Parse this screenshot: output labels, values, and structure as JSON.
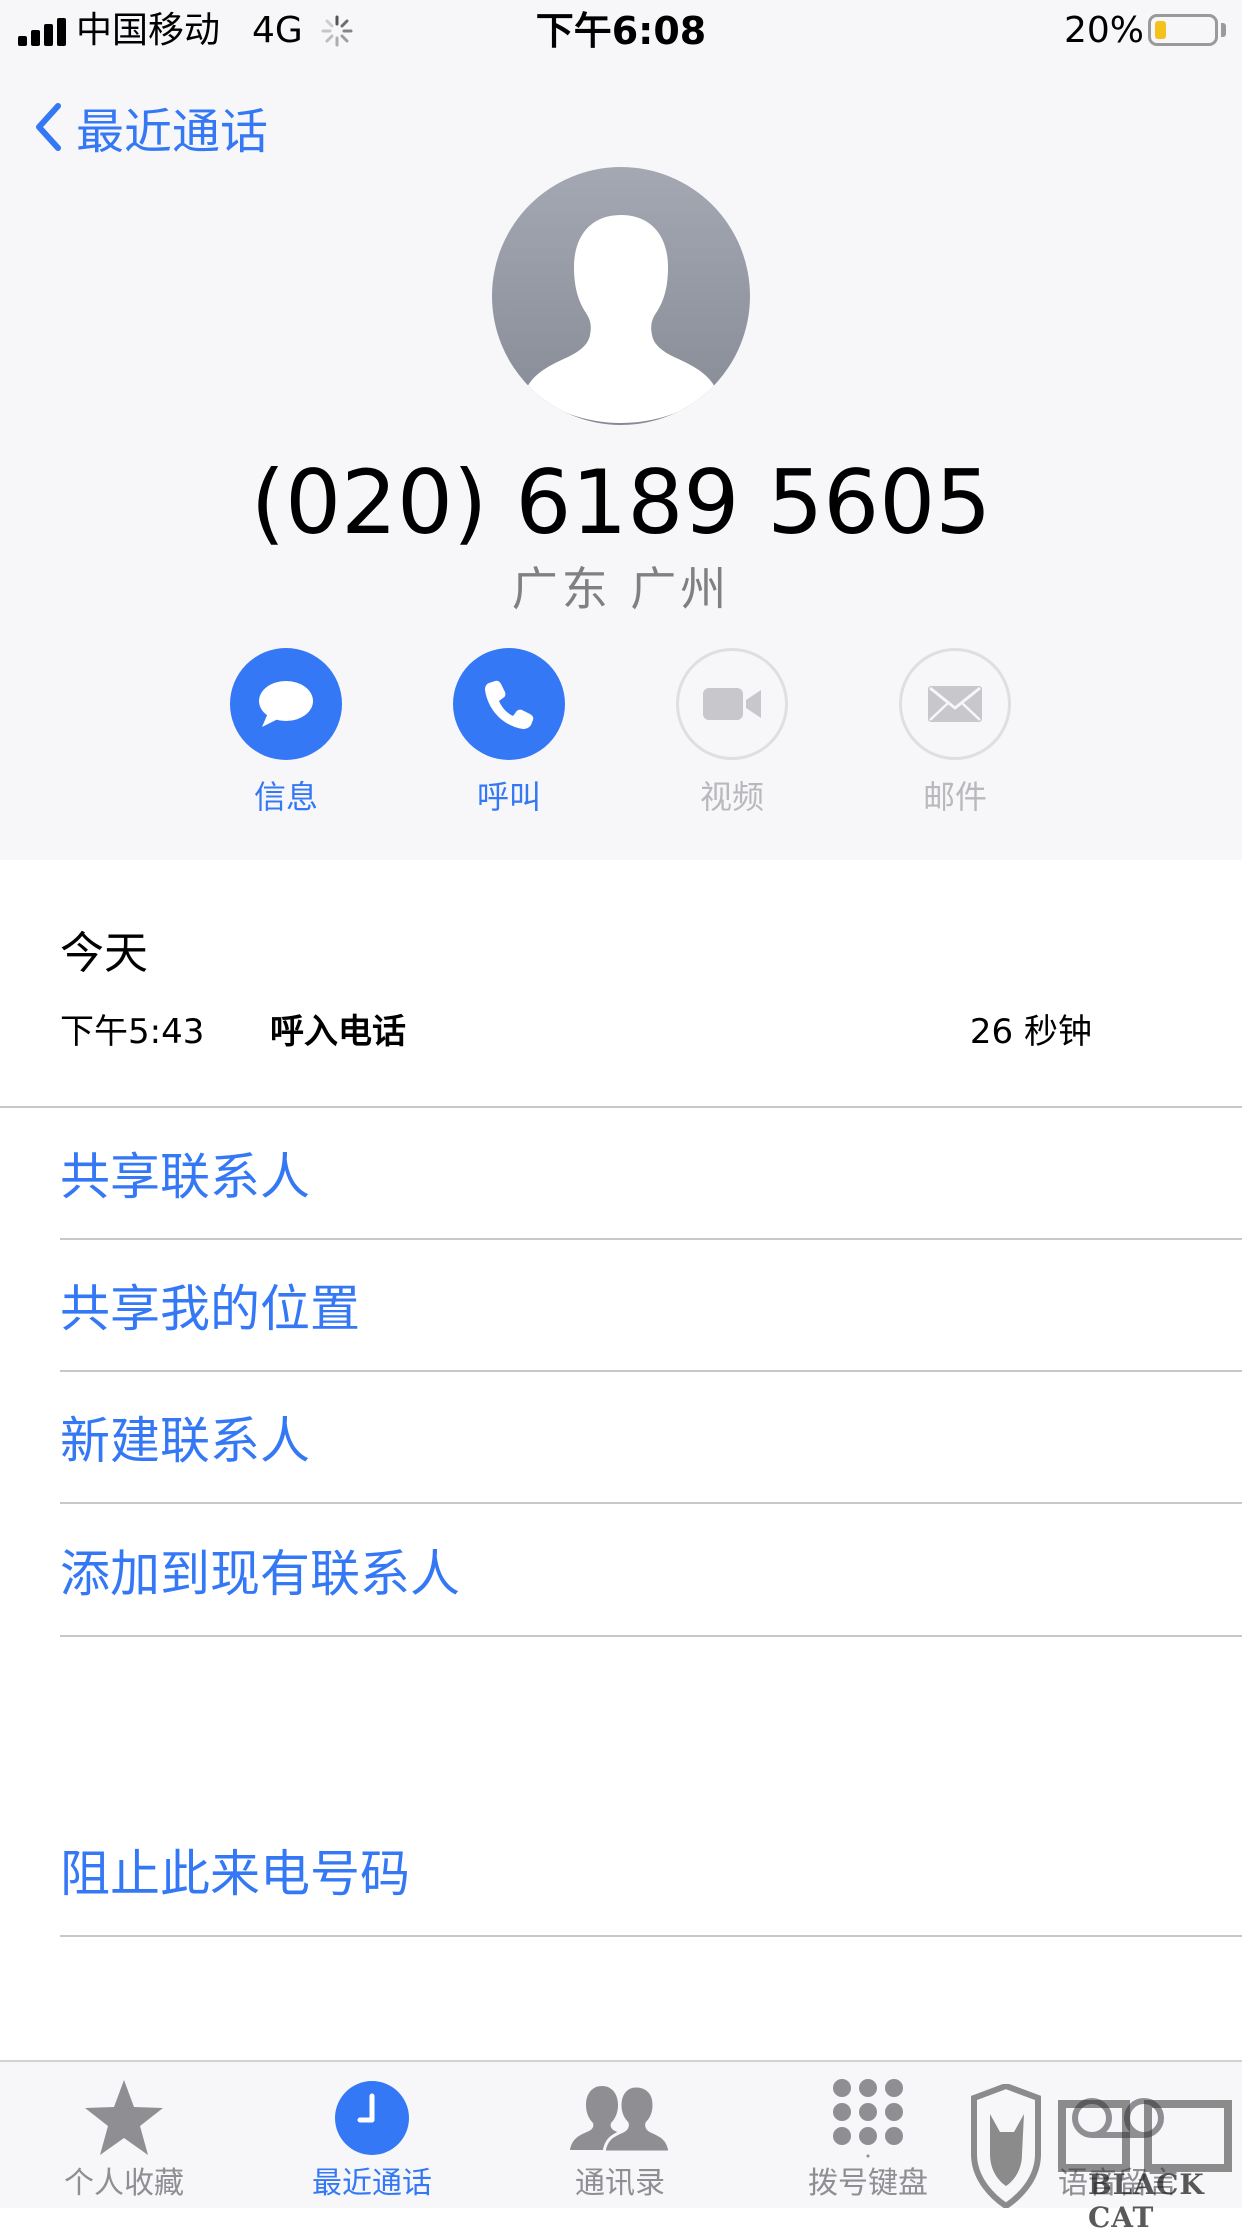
{
  "status_bar": {
    "carrier": "中国移动",
    "network": "4G",
    "time": "下午6:08",
    "battery_percent_text": "20%",
    "battery_level": 0.2,
    "battery_color": "#f4c21b"
  },
  "nav": {
    "back_label": "最近通话"
  },
  "contact": {
    "phone_number": "(020) 6189 5605",
    "location": "广东 广州"
  },
  "actions": [
    {
      "label": "信息",
      "icon": "message-bubble-icon",
      "enabled": true
    },
    {
      "label": "呼叫",
      "icon": "phone-icon",
      "enabled": true
    },
    {
      "label": "视频",
      "icon": "video-camera-icon",
      "enabled": false
    },
    {
      "label": "邮件",
      "icon": "mail-envelope-icon",
      "enabled": false
    }
  ],
  "call_log": {
    "date": "今天",
    "entries": [
      {
        "time": "下午5:43",
        "type": "呼入电话",
        "duration": "26 秒钟"
      }
    ]
  },
  "menu": {
    "items": [
      "共享联系人",
      "共享我的位置",
      "新建联系人",
      "添加到现有联系人"
    ],
    "block": "阻止此来电号码"
  },
  "tabbar": {
    "tabs": [
      {
        "label": "个人收藏",
        "icon": "star-icon",
        "active": false
      },
      {
        "label": "最近通话",
        "icon": "clock-icon",
        "active": true
      },
      {
        "label": "通讯录",
        "icon": "contacts-people-icon",
        "active": false
      },
      {
        "label": "拨号键盘",
        "icon": "keypad-icon",
        "active": false
      },
      {
        "label": "语音留言",
        "icon": "voicemail-icon",
        "active": false
      }
    ]
  },
  "watermark": {
    "text": "BLACK CAT"
  },
  "colors": {
    "accent": "#3478f6",
    "inactive": "#8e8e93",
    "header_bg": "#f7f7f9"
  }
}
